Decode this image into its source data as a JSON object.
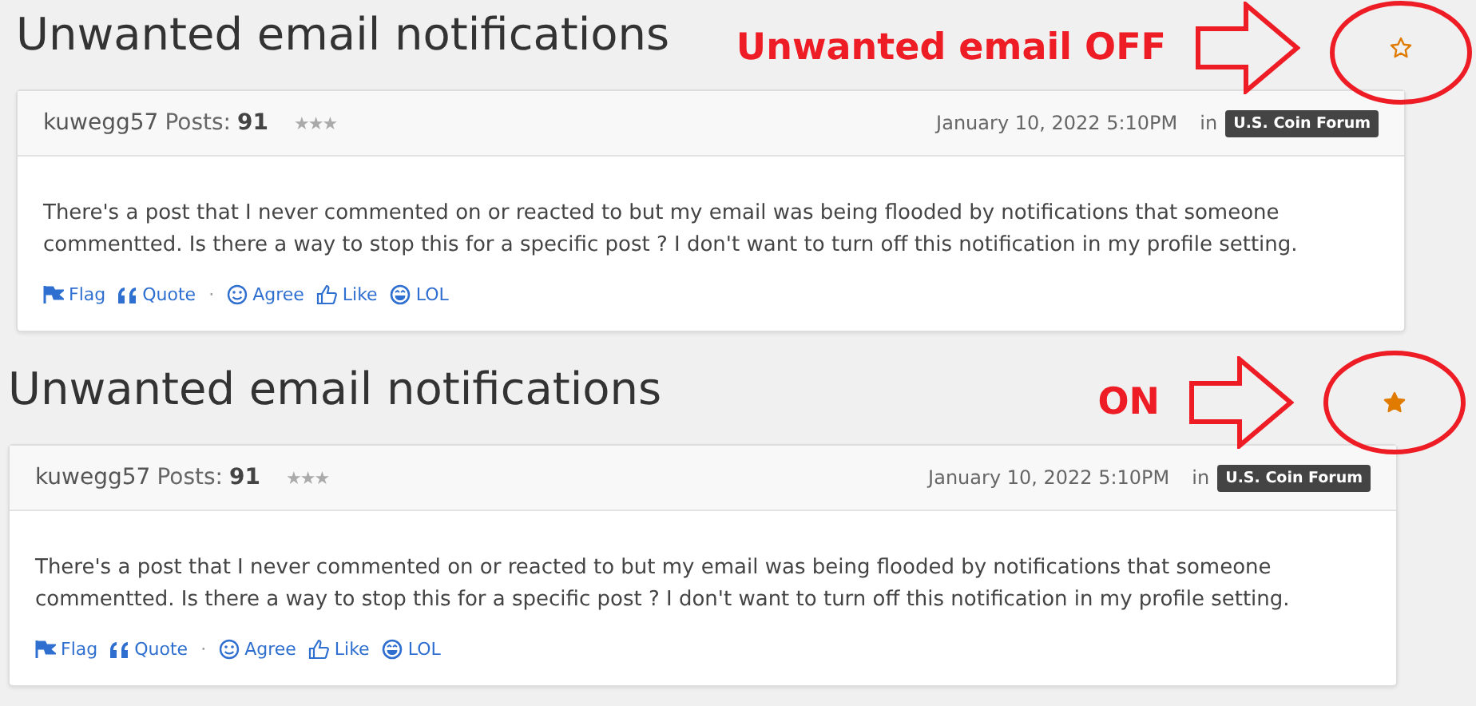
{
  "panels": [
    {
      "title": "Unwanted email notifications",
      "annotation": "Unwanted email OFF",
      "favorite": false,
      "post": {
        "author": "kuwegg57",
        "posts_label": "Posts:",
        "posts": "91",
        "rank": "★★★",
        "date": "January 10, 2022 5:10PM",
        "in_label": "in",
        "category": "U.S. Coin Forum",
        "body": "There's a post that I never commented on or reacted to but my email was being flooded by notifications that someone commentted. Is there a way to stop this for a specific post ? I don't want to turn off this notification in my profile setting.",
        "actions": [
          {
            "kind": "flag",
            "label": "Flag"
          },
          {
            "kind": "quote",
            "label": "Quote"
          },
          {
            "kind": "separator",
            "label": "·"
          },
          {
            "kind": "agree",
            "label": "Agree"
          },
          {
            "kind": "like",
            "label": "Like"
          },
          {
            "kind": "lol",
            "label": "LOL"
          }
        ]
      }
    },
    {
      "title": "Unwanted email notifications",
      "annotation": "ON",
      "favorite": true,
      "post": {
        "author": "kuwegg57",
        "posts_label": "Posts:",
        "posts": "91",
        "rank": "★★★",
        "date": "January 10, 2022 5:10PM",
        "in_label": "in",
        "category": "U.S. Coin Forum",
        "body": "There's a post that I never commented on or reacted to but my email was being flooded by notifications that someone commentted. Is there a way to stop this for a specific post ? I don't want to turn off this notification in my profile setting.",
        "actions": [
          {
            "kind": "flag",
            "label": "Flag"
          },
          {
            "kind": "quote",
            "label": "Quote"
          },
          {
            "kind": "separator",
            "label": "·"
          },
          {
            "kind": "agree",
            "label": "Agree"
          },
          {
            "kind": "like",
            "label": "Like"
          },
          {
            "kind": "lol",
            "label": "LOL"
          }
        ]
      }
    }
  ]
}
